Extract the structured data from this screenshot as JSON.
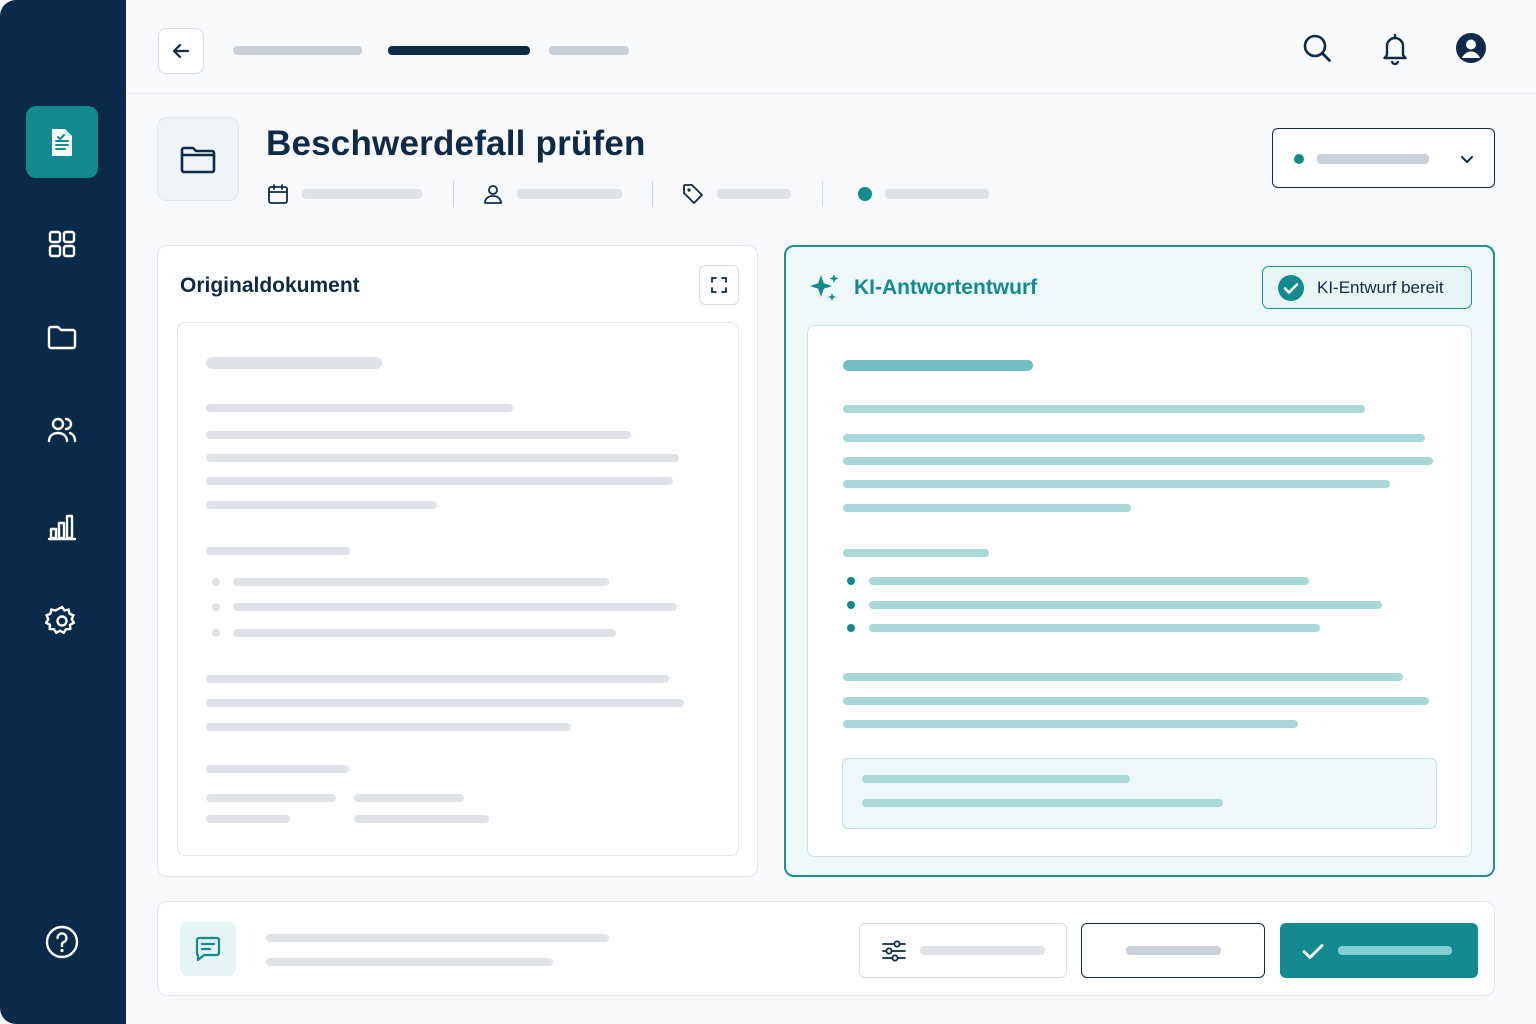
{
  "page": {
    "title": "Beschwerdefall prüfen"
  },
  "panels": {
    "original": {
      "title": "Originaldokument"
    },
    "ai_draft": {
      "title": "KI-Antwortentwurf",
      "status_badge": "KI-Entwurf bereit"
    }
  },
  "colors": {
    "sidebar": "#0b2a4a",
    "accent": "#138a8f",
    "ai_border": "#1f8f93",
    "text": "#0f2a47"
  },
  "icons": {
    "sidebar": [
      "document-icon",
      "grid-icon",
      "folder-icon",
      "users-icon",
      "chart-icon",
      "gear-icon",
      "help-icon"
    ],
    "topbar": [
      "back-arrow-icon",
      "search-icon",
      "bell-icon",
      "user-icon"
    ],
    "meta": [
      "calendar-icon",
      "person-icon",
      "tag-icon",
      "status-dot"
    ]
  }
}
